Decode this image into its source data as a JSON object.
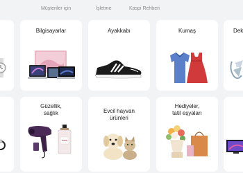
{
  "nav": {
    "customers": "Müşteriler için",
    "business": "İşletme",
    "guide": "Kaspi Rehberi"
  },
  "categories_row1": [
    {
      "label": "",
      "icon": "watch-icon"
    },
    {
      "label": "Bilgisayarlar",
      "icon": "computers-icon"
    },
    {
      "label": "Ayakkabı",
      "icon": "sneaker-icon"
    },
    {
      "label": "Kumaş",
      "icon": "clothing-icon"
    },
    {
      "label": "Dek",
      "icon": "decor-icon"
    }
  ],
  "categories_row2": [
    {
      "label": "",
      "icon": "ring-icon"
    },
    {
      "line1": "Güzellik,",
      "line2": "sağlık",
      "icon": "hairdryer-perfume-icon"
    },
    {
      "line1": "Evcil hayvan",
      "line2": "ürünleri",
      "icon": "pets-icon"
    },
    {
      "line1": "Hediyeler,",
      "line2": "tatil eşyaları",
      "icon": "gifts-icon"
    },
    {
      "label": "",
      "icon": "tv-icon"
    }
  ]
}
